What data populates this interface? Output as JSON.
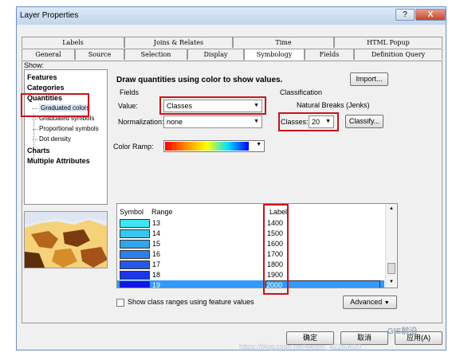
{
  "window": {
    "title": "Layer Properties",
    "help_glyph": "?",
    "close_glyph": "X"
  },
  "tabs_row1": [
    "Labels",
    "Joins & Relates",
    "Time",
    "HTML Popup"
  ],
  "tabs_row2": [
    "General",
    "Source",
    "Selection",
    "Display",
    "Symbology",
    "Fields",
    "Definition Query"
  ],
  "active_tab": "Symbology",
  "show": {
    "label": "Show:",
    "items": [
      "Features",
      "Categories",
      "Quantities",
      "Charts",
      "Multiple Attributes"
    ],
    "sub_items": [
      "Graduated colors",
      "Graduated symbols",
      "Proportional symbols",
      "Dot density"
    ],
    "selected_sub": "Graduated colors"
  },
  "main": {
    "heading": "Draw quantities using color to show values.",
    "import_label": "Import...",
    "fields_label": "Fields",
    "value_label": "Value:",
    "value": "Classes",
    "normalization_label": "Normalization:",
    "normalization": "none",
    "classification_label": "Classification",
    "method": "Natural Breaks (Jenks)",
    "classes_label": "Classes:",
    "classes_value": "20",
    "classify_label": "Classify...",
    "color_ramp_label": "Color Ramp:"
  },
  "table": {
    "headers": {
      "symbol": "Symbol",
      "range": "Range",
      "label": "Label"
    },
    "rows": [
      {
        "range": "13",
        "label": "1400",
        "color": "#3fe6f1"
      },
      {
        "range": "14",
        "label": "1500",
        "color": "#38c6f0"
      },
      {
        "range": "15",
        "label": "1600",
        "color": "#31a4ee"
      },
      {
        "range": "16",
        "label": "1700",
        "color": "#2a80ec"
      },
      {
        "range": "17",
        "label": "1800",
        "color": "#2358ea"
      },
      {
        "range": "18",
        "label": "1900",
        "color": "#1c36e8"
      },
      {
        "range": "19",
        "label": "2000",
        "color": "#1414e6"
      }
    ],
    "selected_row_color": "#3399ff"
  },
  "show_ranges_label": "Show class ranges using feature values",
  "advanced_label": "Advanced",
  "buttons": {
    "ok": "确定",
    "cancel": "取消",
    "apply": "应用(A)"
  },
  "watermark": "https://blog.csdn.net/weixin_42163620",
  "watermark_brand": "GIS前沿",
  "colors": {
    "accent_red": "#c4161c",
    "ramp_start": "#ff0000",
    "ramp_mid": "#ffff00",
    "ramp_end": "#0000ff"
  }
}
